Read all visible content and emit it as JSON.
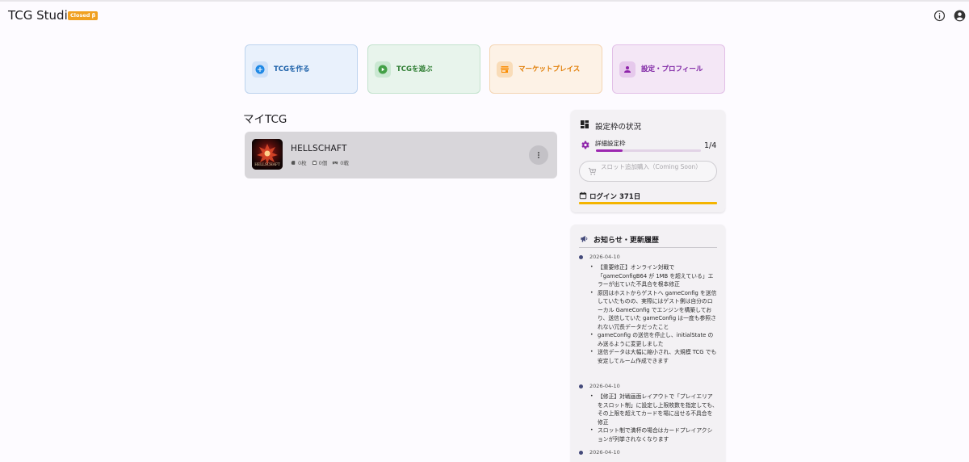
{
  "app": {
    "title": "TCG Studio",
    "badge": "Closed β"
  },
  "header_icons": [
    "info-icon",
    "account-icon"
  ],
  "tiles": [
    {
      "label": "TCGを作る",
      "icon": "add-circle-icon",
      "bg": "#e9f1fc",
      "border": "#bcd3ee",
      "accent": "#1e88e5",
      "text": "#1a5fa8"
    },
    {
      "label": "TCGを遊ぶ",
      "icon": "play-circle-icon",
      "bg": "#e8f4ec",
      "border": "#c3e2cd",
      "accent": "#43a047",
      "text": "#2e7d32"
    },
    {
      "label": "マーケットプレイス",
      "icon": "store-icon",
      "bg": "#fdf2e6",
      "border": "#f4d5b3",
      "accent": "#fb8c00",
      "text": "#e07b00"
    },
    {
      "label": "設定・プロフィール",
      "icon": "person-icon",
      "bg": "#f4e7f6",
      "border": "#e2bfe7",
      "accent": "#8e24aa",
      "text": "#7b1fa2"
    }
  ],
  "my_tcg": {
    "title": "マイTCG",
    "items": [
      {
        "name": "HELLSCHAFT",
        "thumb_text": "HELLSCHAFT",
        "cards": "0枚",
        "packs": "0個",
        "battles": "0戦"
      }
    ]
  },
  "slot_status": {
    "title": "設定枠の状況",
    "label": "詳細設定枠",
    "count": "1/4",
    "progress": 0.25,
    "buy_button": "スロット追加購入（Coming Soon）",
    "login": "ログイン 371日"
  },
  "news": {
    "title": "お知らせ・更新履歴",
    "entries": [
      {
        "date": "2026-04-10",
        "items": [
          "【重要修正】オンライン対戦で「gameConfigB64 が 1MB を超えている」エラーが出ていた不具合を根本修正",
          "原因はホストからゲストへ gameConfig を送信していたものの、実際にはゲスト側は自分のローカル GameConfig でエンジンを構築しており、送信していた gameConfig は一度も参照されない冗長データだったこと",
          "gameConfig の送信を停止し、initialState のみ送るように変更しました",
          "送信データは大幅に縮小され、大規模 TCG でも安定してルーム作成できます"
        ]
      },
      {
        "date": "2026-04-10",
        "items": [
          "【修正】対戦画面レイアウトで「プレイエリアをスロット制」に設定し上限枚数を指定しても、その上限を超えてカードを場に出せる不具合を修正",
          "スロット制で満杯の場合はカードプレイアクションが列挙されなくなります"
        ]
      },
      {
        "date": "2026-04-10",
        "items": []
      }
    ]
  }
}
